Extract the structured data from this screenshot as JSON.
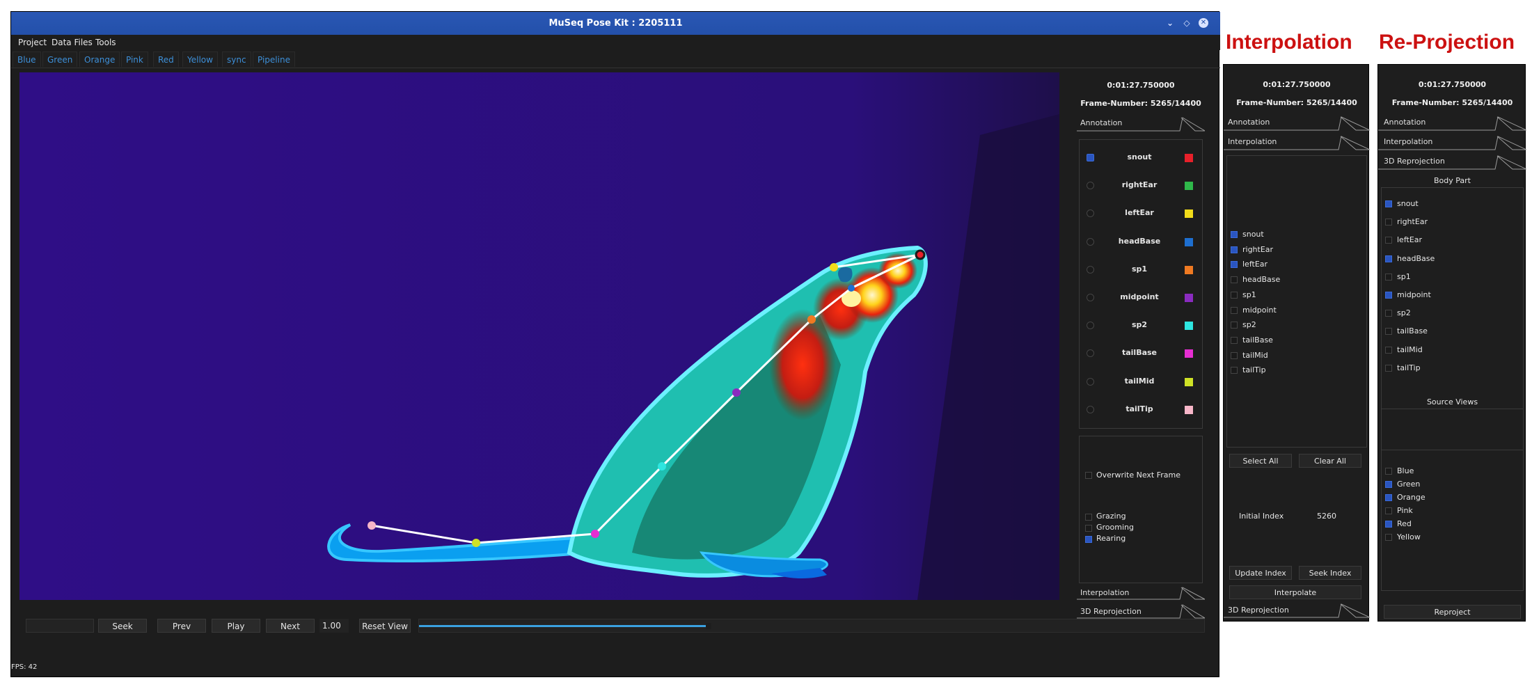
{
  "window": {
    "title": "MuSeq Pose Kit : 2205111"
  },
  "menu": [
    "Project",
    "Data Files",
    "Tools"
  ],
  "tabs": [
    "Blue",
    "Green",
    "Orange",
    "Pink",
    "Red",
    "Yellow",
    "sync",
    "Pipeline"
  ],
  "controls": {
    "seek_input": "",
    "seek": "Seek",
    "prev": "Prev",
    "play": "Play",
    "next": "Next",
    "speed": "1.00",
    "reset_view": "Reset View",
    "progress": 0.365
  },
  "fps": "FPS: 42",
  "main_panel": {
    "time": "0:01:27.750000",
    "frame": "Frame-Number: 5265/14400",
    "annotation": "Annotation",
    "interpolation": "Interpolation",
    "reprojection": "3D Reprojection",
    "overwrite": "Overwrite Next Frame",
    "behaviors": [
      {
        "label": "Grazing",
        "checked": false
      },
      {
        "label": "Grooming",
        "checked": false
      },
      {
        "label": "Rearing",
        "checked": true
      }
    ],
    "body_parts": [
      {
        "label": "snout",
        "color": "#e8202a",
        "selected": true
      },
      {
        "label": "rightEar",
        "color": "#2fb84a",
        "selected": false
      },
      {
        "label": "leftEar",
        "color": "#f2dc1a",
        "selected": false
      },
      {
        "label": "headBase",
        "color": "#1e6fd0",
        "selected": false
      },
      {
        "label": "sp1",
        "color": "#ef7a22",
        "selected": false
      },
      {
        "label": "midpoint",
        "color": "#8a2bbf",
        "selected": false
      },
      {
        "label": "sp2",
        "color": "#2ee6e0",
        "selected": false
      },
      {
        "label": "tailBase",
        "color": "#e62ed2",
        "selected": false
      },
      {
        "label": "tailMid",
        "color": "#cfe226",
        "selected": false
      },
      {
        "label": "tailTip",
        "color": "#f7b6c8",
        "selected": false
      }
    ]
  },
  "interp_heading": "Interpolation",
  "interp_panel": {
    "time": "0:01:27.750000",
    "frame": "Frame-Number: 5265/14400",
    "annotation": "Annotation",
    "interpolation": "Interpolation",
    "reprojection": "3D Reprojection",
    "parts": [
      {
        "label": "snout",
        "checked": true
      },
      {
        "label": "rightEar",
        "checked": true
      },
      {
        "label": "leftEar",
        "checked": true
      },
      {
        "label": "headBase",
        "checked": false
      },
      {
        "label": "sp1",
        "checked": false
      },
      {
        "label": "midpoint",
        "checked": false
      },
      {
        "label": "sp2",
        "checked": false
      },
      {
        "label": "tailBase",
        "checked": false
      },
      {
        "label": "tailMid",
        "checked": false
      },
      {
        "label": "tailTip",
        "checked": false
      }
    ],
    "select_all": "Select All",
    "clear_all": "Clear All",
    "initial_index_label": "Initial Index",
    "initial_index_value": "5260",
    "update_index": "Update Index",
    "seek_index": "Seek Index",
    "interpolate": "Interpolate"
  },
  "reproj_heading": "Re-Projection",
  "reproj_panel": {
    "time": "0:01:27.750000",
    "frame": "Frame-Number: 5265/14400",
    "annotation": "Annotation",
    "interpolation": "Interpolation",
    "reprojection": "3D Reprojection",
    "body_part_title": "Body Part",
    "parts": [
      {
        "label": "snout",
        "checked": true
      },
      {
        "label": "rightEar",
        "checked": false
      },
      {
        "label": "leftEar",
        "checked": false
      },
      {
        "label": "headBase",
        "checked": true
      },
      {
        "label": "sp1",
        "checked": false
      },
      {
        "label": "midpoint",
        "checked": true
      },
      {
        "label": "sp2",
        "checked": false
      },
      {
        "label": "tailBase",
        "checked": false
      },
      {
        "label": "tailMid",
        "checked": false
      },
      {
        "label": "tailTip",
        "checked": false
      }
    ],
    "source_views_title": "Source Views",
    "views": [
      {
        "label": "Blue",
        "checked": false
      },
      {
        "label": "Green",
        "checked": true
      },
      {
        "label": "Orange",
        "checked": true
      },
      {
        "label": "Pink",
        "checked": false
      },
      {
        "label": "Red",
        "checked": true
      },
      {
        "label": "Yellow",
        "checked": false
      }
    ],
    "reproject": "Reproject"
  },
  "keypoints": [
    {
      "name": "snout",
      "color": "#e8202a"
    },
    {
      "name": "rightEar",
      "color": "#2fb84a"
    },
    {
      "name": "leftEar",
      "color": "#f2dc1a"
    },
    {
      "name": "headBase",
      "color": "#1e6fd0"
    },
    {
      "name": "sp1",
      "color": "#ef7a22"
    },
    {
      "name": "midpoint",
      "color": "#8a2bbf"
    },
    {
      "name": "sp2",
      "color": "#2ee6e0"
    },
    {
      "name": "tailBase",
      "color": "#e62ed2"
    },
    {
      "name": "tailMid",
      "color": "#cfe226"
    },
    {
      "name": "tailTip",
      "color": "#f7b6c8"
    }
  ]
}
